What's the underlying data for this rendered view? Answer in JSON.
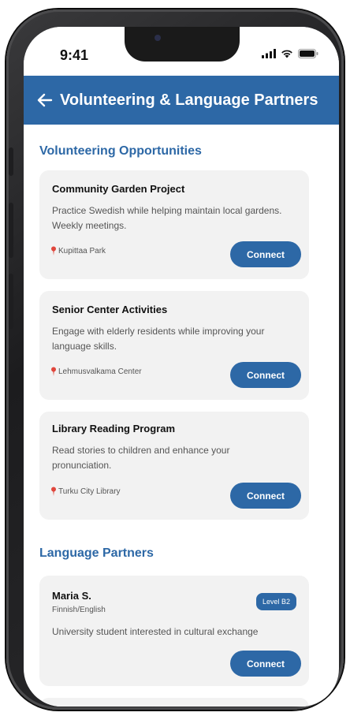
{
  "status_bar": {
    "time": "9:41",
    "icons": [
      "signal-icon",
      "wifi-icon",
      "battery-icon"
    ]
  },
  "header": {
    "back_icon": "arrow-left-icon",
    "title": "Volunteering & Language Partners"
  },
  "volunteering": {
    "section_title": "Volunteering Opportunities",
    "items": [
      {
        "title": "Community Garden Project",
        "description": "Practice Swedish while helping maintain local gardens. Weekly meetings.",
        "location": "Kupittaa Park",
        "button": "Connect"
      },
      {
        "title": "Senior Center Activities",
        "description": "Engage with elderly residents while improving your language skills.",
        "location": "Lehmusvalkama Center",
        "button": "Connect"
      },
      {
        "title": "Library Reading Program",
        "description": "Read stories to children and enhance your pronunciation.",
        "location": "Turku City Library",
        "button": "Connect"
      }
    ]
  },
  "partners": {
    "section_title": "Language Partners",
    "items": [
      {
        "name": "Maria S.",
        "languages": "Finnish/English",
        "level": "Level B2",
        "description": "University student interested in cultural exchange",
        "button": "Connect"
      }
    ]
  },
  "colors": {
    "primary": "#2d68a6",
    "card_bg": "#f2f2f2",
    "pin": "#e0463c"
  }
}
